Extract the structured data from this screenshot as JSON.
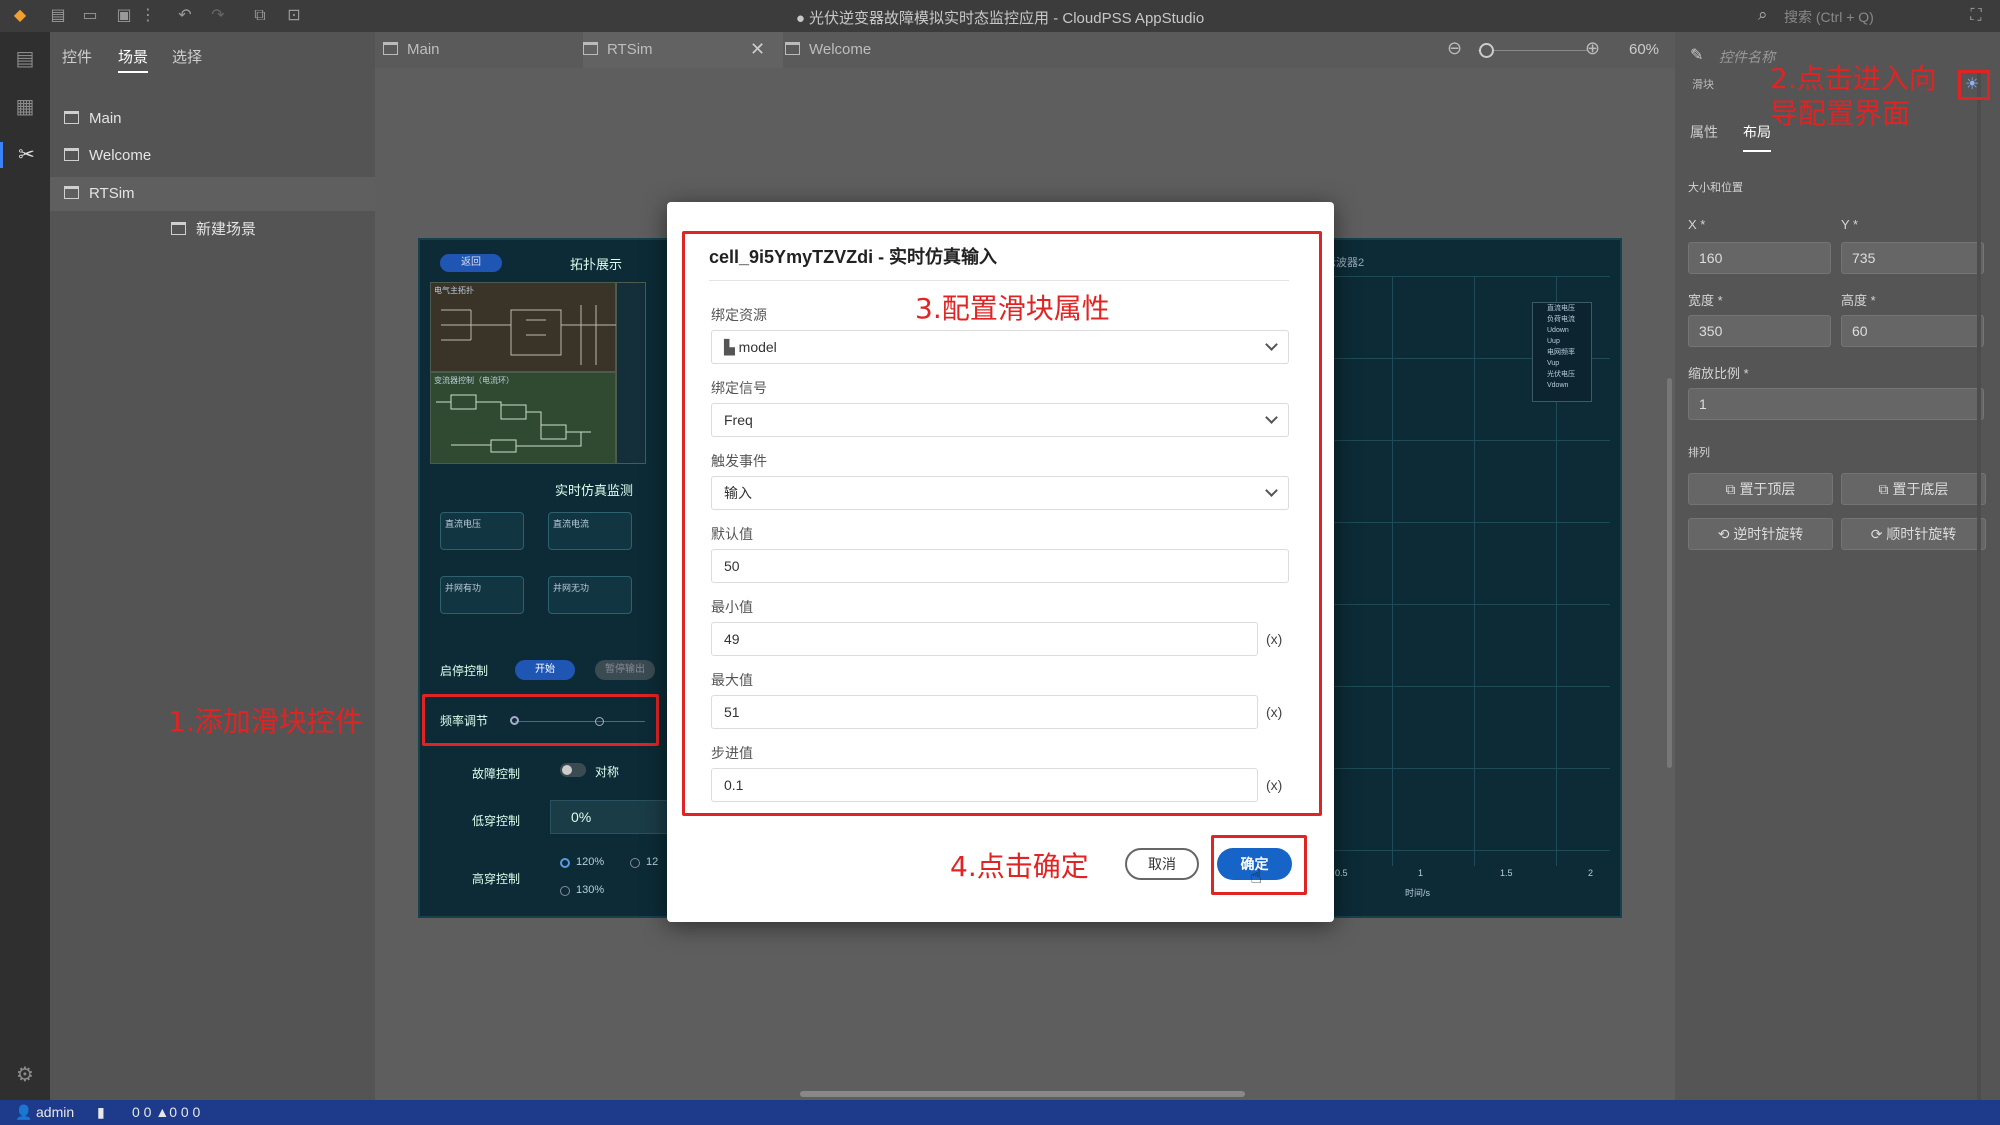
{
  "window": {
    "title": "● 光伏逆变器故障模拟实时态监控应用 - CloudPSS AppStudio",
    "search_placeholder": "搜索 (Ctrl + Q)"
  },
  "explorer": {
    "tabs": [
      "控件",
      "场景",
      "选择"
    ],
    "active_tab": 1,
    "items": [
      "Main",
      "Welcome",
      "RTSim"
    ],
    "sub_items": [
      "新建场景"
    ]
  },
  "doc_tabs": [
    "Main",
    "RTSim",
    "Welcome"
  ],
  "zoom": "60%",
  "right_panel": {
    "control_name_placeholder": "控件名称",
    "control_type": "滑块",
    "tabs": [
      "属性",
      "布局"
    ],
    "section_size": "大小和位置",
    "x_label": "X",
    "x_value": "160",
    "y_label": "Y",
    "y_value": "735",
    "width_label": "宽度",
    "width_value": "350",
    "height_label": "高度",
    "height_value": "60",
    "scale_label": "缩放比例",
    "scale_value": "1",
    "section_arrange": "排列",
    "btn_top": "置于顶层",
    "btn_bottom": "置于底层",
    "btn_ccw": "逆时针旋转",
    "btn_cw": "顺时针旋转"
  },
  "dashboard": {
    "header_btn": "返回",
    "topology_title": "拓扑展示",
    "electrical_label": "电气主拓扑",
    "control_label": "变流器控制（电流环）",
    "monitor_title": "实时仿真监测",
    "monitors": [
      "直流电压",
      "直流电流",
      "并网有功",
      "并网无功"
    ],
    "start_stop_label": "启停控制",
    "start_btn": "开始",
    "pause_btn": "暂停输出",
    "freq_label": "频率调节",
    "fault_label": "故障控制",
    "fault_toggle": "对称",
    "low_label": "低穿控制",
    "low_value": "0%",
    "high_label": "高穿控制",
    "high_opts": [
      "120%",
      "12",
      "130%"
    ],
    "scope_title": "示波器2",
    "scope_xlabel": "时间/s",
    "scope_ticks": [
      "0.5",
      "1",
      "1.5",
      "2"
    ],
    "legend": [
      "直流电压",
      "负荷电流",
      "Udown",
      "Uup",
      "电网频率",
      "Vup",
      "光伏电压",
      "Vdown"
    ]
  },
  "dialog": {
    "title": "cell_9i5YmyTZVZdi - 实时仿真输入",
    "resource_label": "绑定资源",
    "resource_value": "model",
    "signal_label": "绑定信号",
    "signal_value": "Freq",
    "event_label": "触发事件",
    "event_value": "输入",
    "default_label": "默认值",
    "default_value": "50",
    "min_label": "最小值",
    "min_value": "49",
    "max_label": "最大值",
    "max_value": "51",
    "step_label": "步进值",
    "step_value": "0.1",
    "x_suffix": "(x)",
    "cancel": "取消",
    "confirm": "确定"
  },
  "annotations": {
    "a1": "1.添加滑块控件",
    "a2_line1": "2.点击进入向",
    "a2_line2": "导配置界面",
    "a3": "3.配置滑块属性",
    "a4": "4.点击确定"
  },
  "status": {
    "user": "admin",
    "counts": "0 0 ▲0 0 0"
  },
  "colors": {
    "accent": "#1664c8",
    "annotation": "#e02424",
    "status_bar": "#1e3a8a"
  }
}
